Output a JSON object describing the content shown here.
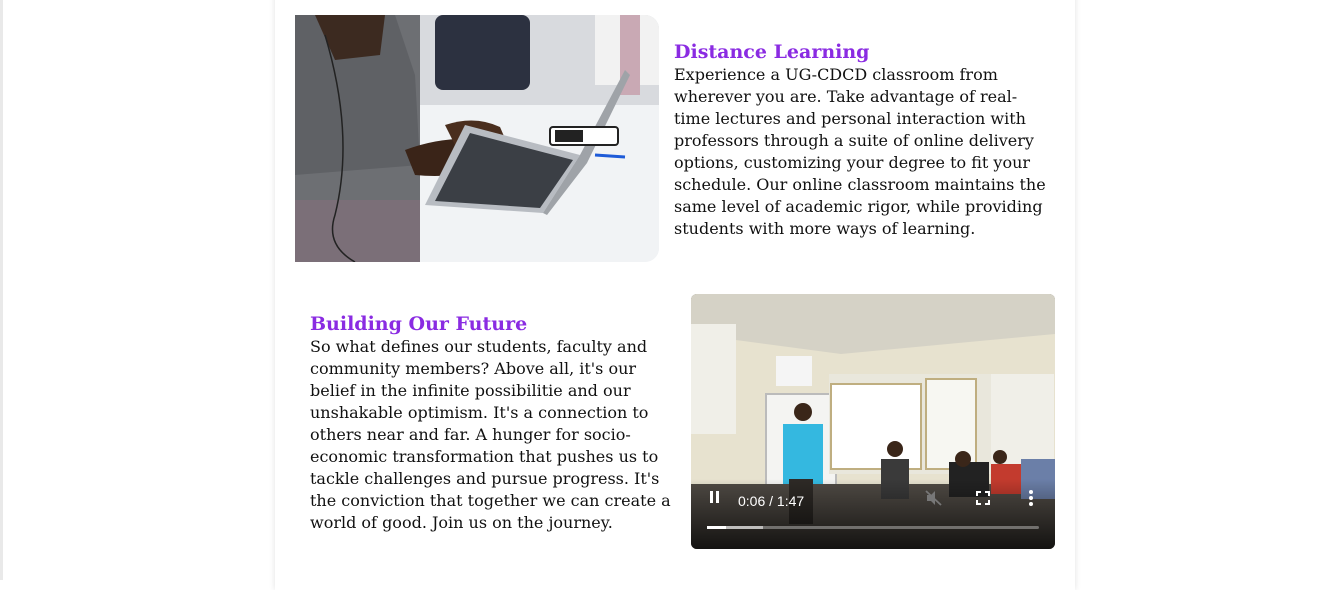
{
  "sections": {
    "distance": {
      "title": "Distance Learning",
      "body": "Experience a UG-CDCD classroom from wherever you are. Take advantage of real-time lectures and personal interaction with professors through a suite of online delivery options, customizing your degree to fit your schedule. Our online classroom maintains the same level of academic rigor, while providing students with more ways of learning."
    },
    "future": {
      "title": "Building Our Future",
      "body": "So what defines our students, faculty and community members? Above all, it's our belief in the infinite possibilitie and our unshakable optimism. It's a connection to others near and far. A hunger for socio-economic transformation that pushes us to tackle challenges and pursue progress. It's the conviction that together we can create a world of good. Join us on the journey."
    }
  },
  "video": {
    "time_display": "0:06 / 1:47",
    "progress_fraction": 0.056,
    "buffered_fraction": 0.17,
    "state": "playing",
    "muted": true
  },
  "colors": {
    "heading": "#8a2be2",
    "body_text": "#111111"
  },
  "icons": [
    "pause-icon",
    "mute-icon",
    "fullscreen-icon",
    "more-options-icon"
  ]
}
